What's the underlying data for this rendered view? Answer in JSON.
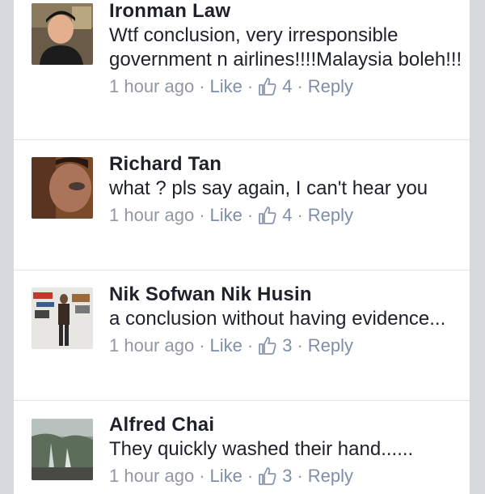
{
  "comments": [
    {
      "name": "Ironman Law",
      "text": "Wtf conclusion, very irresponsible government n airlines!!!!Malaysia boleh!!!",
      "time": "1 hour ago",
      "like_label": "Like",
      "like_count": "4",
      "reply_label": "Reply",
      "separator": "·"
    },
    {
      "name": "Richard Tan",
      "text": "what ? pls say again, I can't hear you",
      "time": "1 hour ago",
      "like_label": "Like",
      "like_count": "4",
      "reply_label": "Reply",
      "separator": "·"
    },
    {
      "name": "Nik Sofwan Nik Husin",
      "text": "a conclusion without having evidence...",
      "time": "1 hour ago",
      "like_label": "Like",
      "like_count": "3",
      "reply_label": "Reply",
      "separator": "·"
    },
    {
      "name": "Alfred Chai",
      "text": "They quickly washed their hand......",
      "time": "1 hour ago",
      "like_label": "Like",
      "like_count": "3",
      "reply_label": "Reply",
      "separator": "·"
    }
  ],
  "colors": {
    "name_text": "#1d2129",
    "meta_text": "#9197a3",
    "link_text": "#7f8ea8",
    "like_icon": "#8b96ae",
    "page_background": "#d6d9de"
  },
  "icons": {
    "like": "thumbs-up-icon"
  }
}
